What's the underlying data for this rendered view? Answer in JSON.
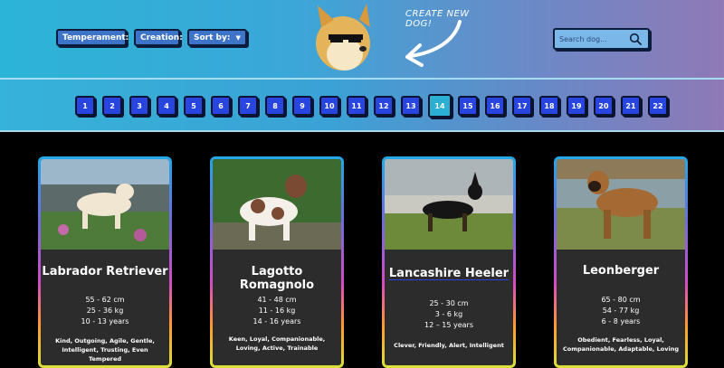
{
  "filters": {
    "temperament_label": "Temperament:",
    "creation_label": "Creation:",
    "sortby_label": "Sort by:"
  },
  "header": {
    "create_label": "CREATE NEW DOG!"
  },
  "search": {
    "placeholder": "Search dog..."
  },
  "pagination": {
    "pages": [
      "1",
      "2",
      "3",
      "4",
      "5",
      "6",
      "7",
      "8",
      "9",
      "10",
      "11",
      "12",
      "13",
      "14",
      "15",
      "16",
      "17",
      "18",
      "19",
      "20",
      "21",
      "22"
    ],
    "current": "14"
  },
  "cards": [
    {
      "name": "Labrador Retriever",
      "height": "55 - 62 cm",
      "weight": "25 - 36 kg",
      "life": "10 - 13 years",
      "temperament": "Kind, Outgoing, Agile, Gentle, Intelligent, Trusting, Even Tempered"
    },
    {
      "name": "Lagotto Romagnolo",
      "height": "41 - 48 cm",
      "weight": "11 - 16 kg",
      "life": "14 - 16 years",
      "temperament": "Keen, Loyal, Companionable, Loving, Active, Trainable"
    },
    {
      "name": "Lancashire Heeler",
      "height": "25 - 30 cm",
      "weight": "3 - 6 kg",
      "life": "12 – 15 years",
      "temperament": "Clever, Friendly, Alert, Intelligent"
    },
    {
      "name": "Leonberger",
      "height": "65 - 80 cm",
      "weight": "54 - 77 kg",
      "life": "6 - 8 years",
      "temperament": "Obedient, Fearless, Loyal, Companionable, Adaptable, Loving"
    }
  ],
  "colors": {
    "page_button": "#2945e0",
    "page_button_active": "#2bb0d4"
  }
}
